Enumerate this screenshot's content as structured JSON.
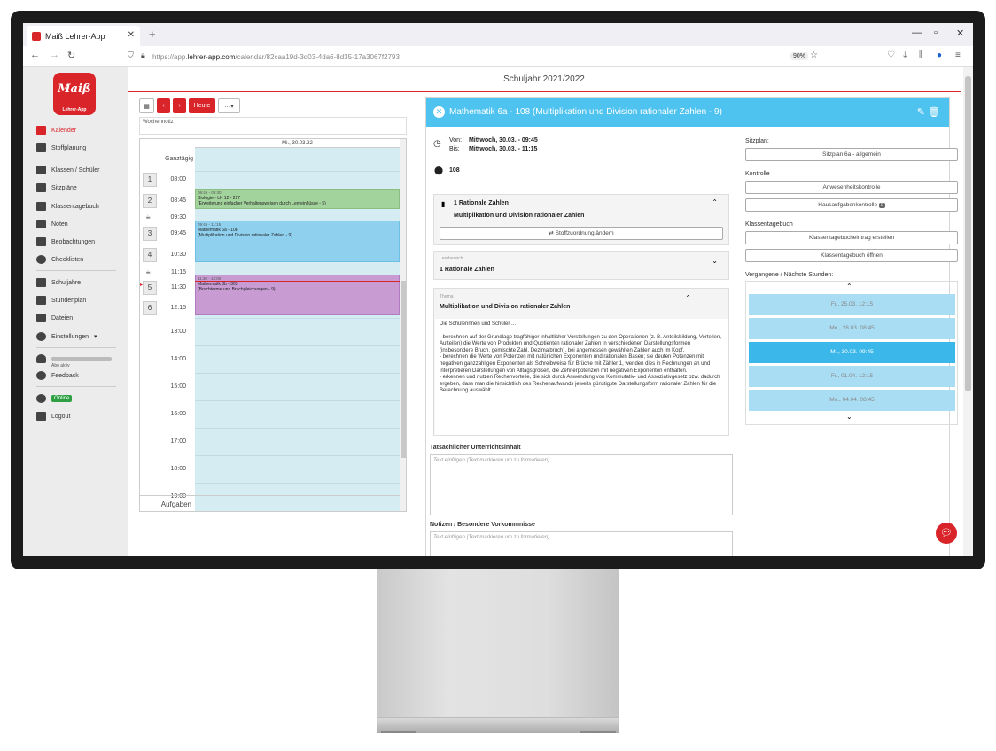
{
  "browser": {
    "tab_title": "Maiß Lehrer-App",
    "url_prefix": "https://app.",
    "url_host": "lehrer-app.com",
    "url_path": "/calendar/82caa19d-3d03-4da6-8d35-17a3067f2793",
    "zoom": "90%"
  },
  "logo": {
    "text": "Maiß",
    "sub": "Lehrer-App"
  },
  "sidebar": {
    "items": [
      {
        "label": "Kalender",
        "icon": "calendar-icon",
        "active": true
      },
      {
        "label": "Stoffplanung",
        "icon": "plan-icon"
      },
      {
        "label": "Klassen / Schüler",
        "icon": "users-icon"
      },
      {
        "label": "Sitzpläne",
        "icon": "grid-icon"
      },
      {
        "label": "Klassentagebuch",
        "icon": "book-icon"
      },
      {
        "label": "Noten",
        "icon": "grade-icon"
      },
      {
        "label": "Beobachtungen",
        "icon": "binoculars-icon"
      },
      {
        "label": "Checklisten",
        "icon": "check-icon"
      },
      {
        "label": "Schuljahre",
        "icon": "graduation-icon"
      },
      {
        "label": "Stundenplan",
        "icon": "timetable-icon"
      },
      {
        "label": "Dateien",
        "icon": "file-icon"
      },
      {
        "label": "Einstellungen",
        "icon": "gear-icon"
      }
    ],
    "abo": "Abo aktiv",
    "feedback": "Feedback",
    "online": "Online",
    "logout": "Logout"
  },
  "header": {
    "title": "Schuljahr 2021/2022"
  },
  "calendar": {
    "today_btn": "Heute",
    "more_btn": "…",
    "weeknote_placeholder": "Wochennotiz",
    "day_label": "Mi., 30.03.22",
    "allday": "Ganztägig",
    "tasks": "Aufgaben",
    "periods": [
      {
        "num": "1",
        "time": "08:00"
      },
      {
        "num": "2",
        "time": "08:45"
      },
      {
        "num": "",
        "time": "09:30"
      },
      {
        "num": "3",
        "time": "09:45"
      },
      {
        "num": "4",
        "time": "10:30"
      },
      {
        "num": "",
        "time": "11:15"
      },
      {
        "num": "5",
        "time": "11:30"
      },
      {
        "num": "6",
        "time": "12:15"
      }
    ],
    "hours": [
      "13:00",
      "14:00",
      "15:00",
      "16:00",
      "17:00",
      "18:00",
      "19:00"
    ],
    "events": [
      {
        "time": "08:45 - 09:30",
        "title": "Biologie - LK 12 - 217",
        "sub": "(Erweiterung einfacher Verhaltensweisen durch Lerneinflüsse - 5)",
        "color": "#a3d39c"
      },
      {
        "time": "09:45 - 11:15",
        "title": "Mathematik 6a - 108",
        "sub": "(Multiplikation und Division rationaler Zahlen - 9)",
        "color": "#8fd0ee"
      },
      {
        "time": "11:30 - 13:00",
        "title": "Mathematik 8b - 303",
        "sub": "(Bruchterme und Bruchgleichungen - 9)",
        "color": "#c89bd3"
      }
    ]
  },
  "detail": {
    "title": "Mathematik 6a - 108 (Multiplikation und Division rationaler Zahlen - 9)",
    "von_label": "Von:",
    "von_value": "Mittwoch, 30.03. - 09:45",
    "bis_label": "Bis:",
    "bis_value": "Mittwoch, 30.03. - 11:15",
    "room": "108",
    "topic_title": "1 Rationale Zahlen",
    "topic_sub": "Multiplikation und Division rationaler Zahlen",
    "assign_btn": "Stoffzuordnung ändern",
    "lernbereich_cap": "Lernbereich",
    "lernbereich": "1 Rationale Zahlen",
    "thema_cap": "Thema",
    "thema": "Multiplikation und Division rationaler Zahlen",
    "thema_text": [
      "Die Schülerinnen und Schüler ...",
      "",
      "- berechnen auf der Grundlage tragfähiger inhaltlicher Vorstellungen zu den Operationen (z. B. Anteilsbildung, Verteilen, Aufteilen) die Werte von Produkten und Quotienten rationaler Zahlen in verschiedenen Darstellungsformen (insbesondere Bruch, gemischte Zahl, Dezimalbruch), bei angemessen gewählten Zahlen auch im Kopf.",
      "- berechnen die Werte von Potenzen mit natürlichen Exponenten und rationalen Basen; sie deuten Potenzen mit negativen ganzzahligen Exponenten als Schreibweise für Brüche mit Zähler 1, wenden dies in Rechnungen an und interpretieren Darstellungen von Alltagsgrößen, die Zehnerpotenzen mit negativen Exponenten enthalten.",
      "- erkennen und nutzen Rechenvorteile, die sich durch Anwendung von Kommutativ- und Assoziativgesetz bzw. dadurch ergeben, dass man die hinsichtlich des Rechenaufwands jeweils günstigste Darstellungsform rationaler Zahlen für die Berechnung auswählt."
    ],
    "actual_label": "Tatsächlicher Unterrichtsinhalt",
    "actual_placeholder": "Text einfügen (Text markieren um zu formatieren)...",
    "notes_label": "Notizen / Besondere Vorkommnisse",
    "notes_placeholder": "Text einfügen (Text markieren um zu formatieren)..."
  },
  "right": {
    "sitzplan_label": "Sitzplan:",
    "sitzplan_btn": "Sitzplan 6a - allgemein",
    "kontrolle_label": "Kontrolle",
    "anwesenheit_btn": "Anwesenheitskontrolle",
    "hausaufgaben_btn": "Hausaufgabenkontrolle",
    "hausaufgaben_count": "0",
    "ktb_label": "Klassentagebuch",
    "ktb_create_btn": "Klassentagebucheintrag erstellen",
    "ktb_open_btn": "Klassentagebuch öffnen",
    "past_label": "Vergangene / Nächste Stunden:",
    "lessons": [
      {
        "label": "Fr., 25.03. 12:15",
        "current": false
      },
      {
        "label": "Mo., 28.03. 08:45",
        "current": false
      },
      {
        "label": "Mi., 30.03. 09:45",
        "current": true
      },
      {
        "label": "Fr., 01.04. 12:15",
        "current": false
      },
      {
        "label": "Mo., 04.04. 08:45",
        "current": false
      }
    ]
  },
  "colors": {
    "brand": "#d9242a",
    "accent": "#4fc3ef"
  }
}
